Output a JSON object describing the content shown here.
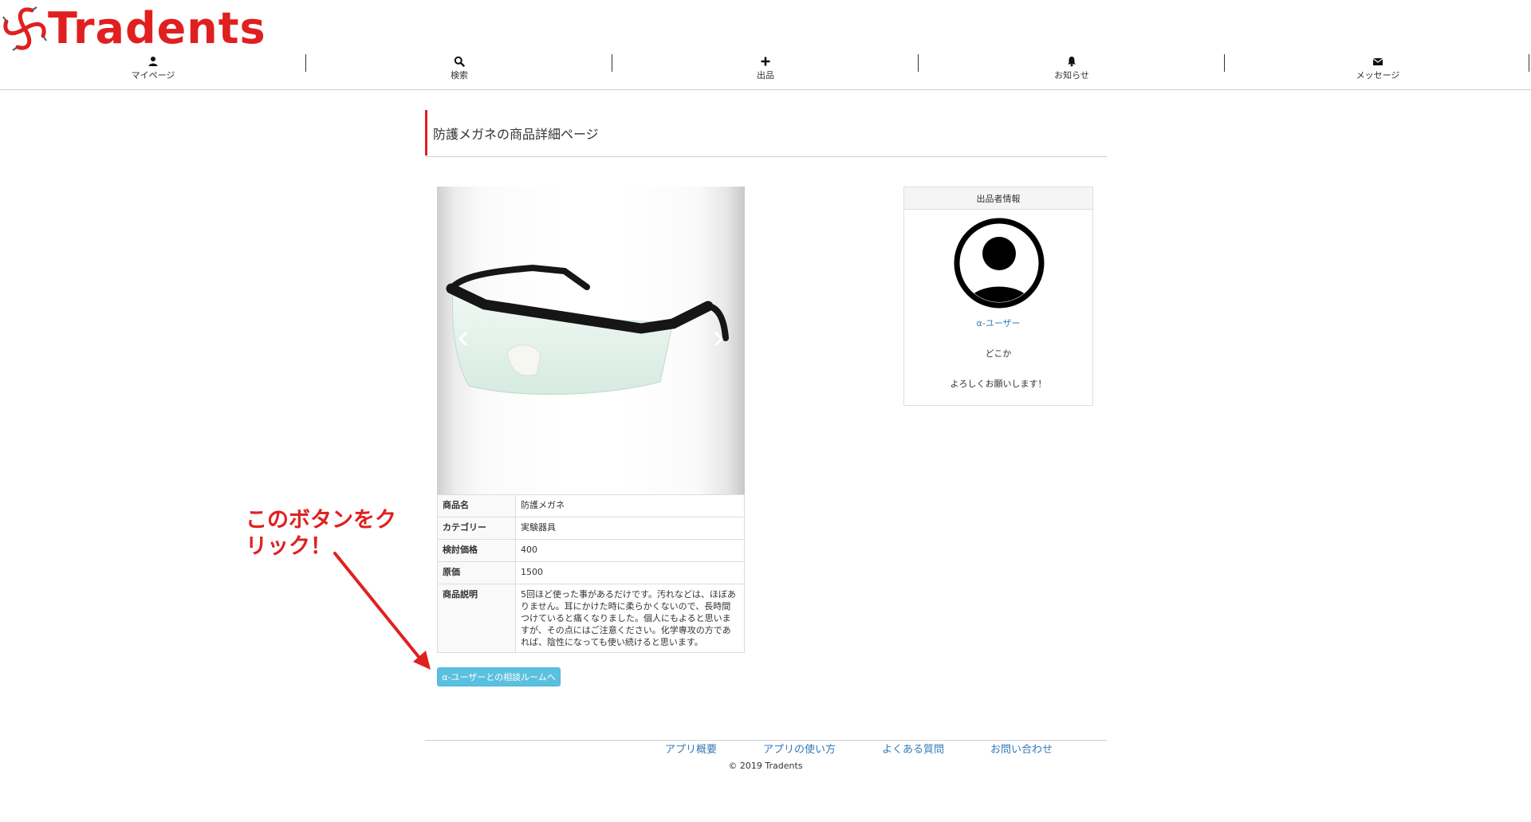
{
  "brand": {
    "name": "Tradents",
    "color": "#e02020"
  },
  "nav": [
    {
      "icon": "user-icon",
      "label": "マイページ"
    },
    {
      "icon": "search-icon",
      "label": "検索"
    },
    {
      "icon": "plus-icon",
      "label": "出品"
    },
    {
      "icon": "bell-icon",
      "label": "お知らせ"
    },
    {
      "icon": "envelope-icon",
      "label": "メッセージ"
    }
  ],
  "page": {
    "title": "防護メガネの商品詳細ページ"
  },
  "product": {
    "image_alt": "防護メガネ",
    "rows": [
      {
        "key": "商品名",
        "value": "防護メガネ"
      },
      {
        "key": "カテゴリー",
        "value": "実験器具"
      },
      {
        "key": "検討価格",
        "value": "400"
      },
      {
        "key": "原価",
        "value": "1500"
      },
      {
        "key": "商品説明",
        "value": "5回ほど使った事があるだけです。汚れなどは、ほぼありません。耳にかけた時に柔らかくないので、長時間つけていると痛くなりました。個人にもよると思いますが、その点にはご注意ください。化学専攻の方であれば、陰性になっても使い続けると思います。"
      }
    ]
  },
  "action": {
    "room_button_label": "α-ユーザーとの相談ルームへ",
    "color": "#5bc0de"
  },
  "seller": {
    "header": "出品者情報",
    "name": "α-ユーザー",
    "location": "どこか",
    "message": "よろしくお願いします！"
  },
  "annotation": {
    "line1": "このボタンをク",
    "line2": "リック！",
    "color": "#e02020"
  },
  "footer": {
    "links": [
      "アプリ概要",
      "アプリの使い方",
      "よくある質問",
      "お問い合わせ"
    ],
    "copyright": "© 2019 Tradents"
  }
}
